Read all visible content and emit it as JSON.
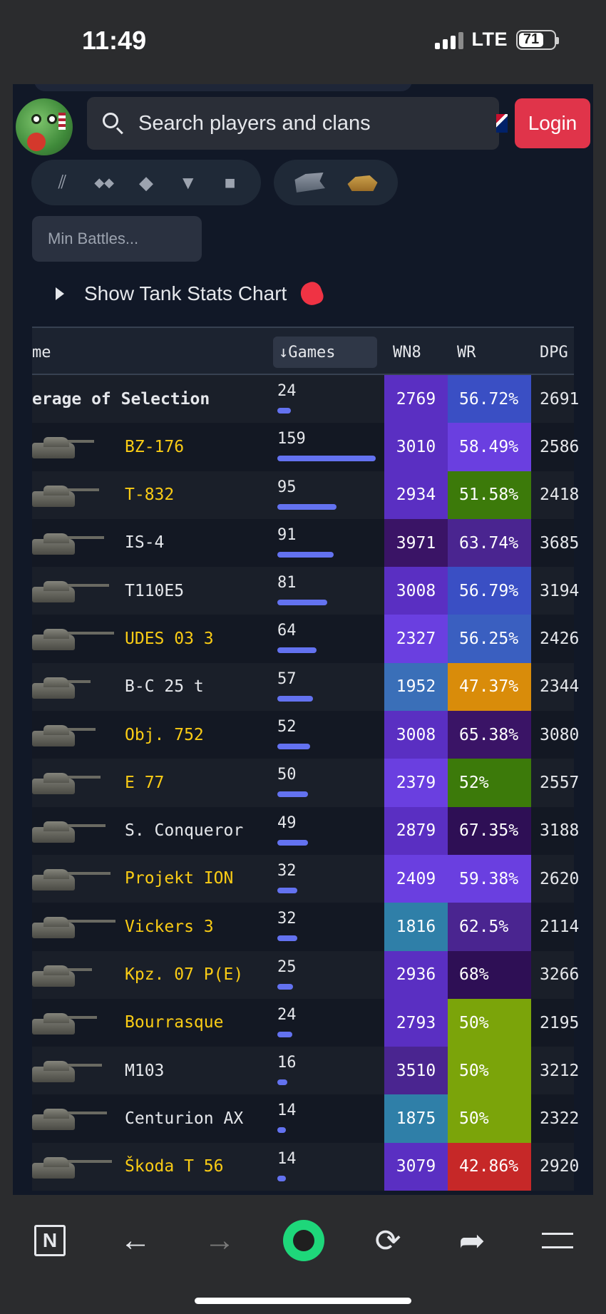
{
  "status_bar": {
    "time": "11:49",
    "network": "LTE",
    "battery": "71"
  },
  "header": {
    "search_placeholder": "Search players and clans",
    "login_label": "Login"
  },
  "filters": {
    "tier_icons": [
      "tier-x-icon",
      "tier-ix-icon",
      "diamond-icon",
      "triangle-down-icon",
      "square-icon"
    ],
    "tier_glyphs": [
      "⫽",
      "◆◆",
      "◆",
      "▼",
      "■"
    ],
    "type_icons": [
      "tank-type-heavy-icon",
      "tank-type-gold-icon"
    ],
    "min_battles_placeholder": "Min Battles...",
    "chart_toggle_label": "Show Tank Stats Chart"
  },
  "table": {
    "columns": {
      "name": "me",
      "games": "↓Games",
      "wn8": "WN8",
      "wr": "WR",
      "dpg": "DPG"
    },
    "rows": [
      {
        "name": "erage of Selection",
        "premium": false,
        "games": "24",
        "bar": 0.14,
        "wn8": "2769",
        "wn8_color": "#5a2fc2",
        "wr": "56.72%",
        "wr_color": "#3a4fc4",
        "dpg": "2691",
        "summary": true
      },
      {
        "name": "BZ-176",
        "premium": true,
        "games": "159",
        "bar": 1.0,
        "wn8": "3010",
        "wn8_color": "#5a2fc2",
        "wr": "58.49%",
        "wr_color": "#6a3fe0",
        "dpg": "2586"
      },
      {
        "name": "T-832",
        "premium": true,
        "games": "95",
        "bar": 0.6,
        "wn8": "2934",
        "wn8_color": "#5a2fc2",
        "wr": "51.58%",
        "wr_color": "#3c7a0a",
        "dpg": "2418"
      },
      {
        "name": "IS-4",
        "premium": false,
        "games": "91",
        "bar": 0.57,
        "wn8": "3971",
        "wn8_color": "#3a1466",
        "wr": "63.74%",
        "wr_color": "#4a2590",
        "dpg": "3685"
      },
      {
        "name": "T110E5",
        "premium": false,
        "games": "81",
        "bar": 0.51,
        "wn8": "3008",
        "wn8_color": "#5a2fc2",
        "wr": "56.79%",
        "wr_color": "#3a4fc4",
        "dpg": "3194"
      },
      {
        "name": "UDES 03 3",
        "premium": true,
        "games": "64",
        "bar": 0.4,
        "wn8": "2327",
        "wn8_color": "#6a3fe0",
        "wr": "56.25%",
        "wr_color": "#3a5fc0",
        "dpg": "2426"
      },
      {
        "name": "B-C 25 t",
        "premium": false,
        "games": "57",
        "bar": 0.36,
        "wn8": "1952",
        "wn8_color": "#3a6fb8",
        "wr": "47.37%",
        "wr_color": "#d98c0a",
        "dpg": "2344"
      },
      {
        "name": "Obj. 752",
        "premium": true,
        "games": "52",
        "bar": 0.33,
        "wn8": "3008",
        "wn8_color": "#5a2fc2",
        "wr": "65.38%",
        "wr_color": "#3a1466",
        "dpg": "3080"
      },
      {
        "name": "E 77",
        "premium": true,
        "games": "50",
        "bar": 0.31,
        "wn8": "2379",
        "wn8_color": "#6a3fe0",
        "wr": "52%",
        "wr_color": "#3c7a0a",
        "dpg": "2557"
      },
      {
        "name": "S. Conqueror",
        "premium": false,
        "games": "49",
        "bar": 0.31,
        "wn8": "2879",
        "wn8_color": "#5a2fc2",
        "wr": "67.35%",
        "wr_color": "#2e0f55",
        "dpg": "3188"
      },
      {
        "name": "Projekt ION",
        "premium": true,
        "games": "32",
        "bar": 0.2,
        "wn8": "2409",
        "wn8_color": "#6a3fe0",
        "wr": "59.38%",
        "wr_color": "#6a3fe0",
        "dpg": "2620"
      },
      {
        "name": "Vickers 3",
        "premium": true,
        "games": "32",
        "bar": 0.2,
        "wn8": "1816",
        "wn8_color": "#2f7fa8",
        "wr": "62.5%",
        "wr_color": "#4a2590",
        "dpg": "2114"
      },
      {
        "name": "Kpz. 07 P(E)",
        "premium": true,
        "games": "25",
        "bar": 0.16,
        "wn8": "2936",
        "wn8_color": "#5a2fc2",
        "wr": "68%",
        "wr_color": "#2e0f55",
        "dpg": "3266"
      },
      {
        "name": "Bourrasque",
        "premium": true,
        "games": "24",
        "bar": 0.15,
        "wn8": "2793",
        "wn8_color": "#5a2fc2",
        "wr": "50%",
        "wr_color": "#7ba40a",
        "dpg": "2195"
      },
      {
        "name": "M103",
        "premium": false,
        "games": "16",
        "bar": 0.1,
        "wn8": "3510",
        "wn8_color": "#4a2590",
        "wr": "50%",
        "wr_color": "#7ba40a",
        "dpg": "3212"
      },
      {
        "name": "Centurion AX",
        "premium": false,
        "games": "14",
        "bar": 0.09,
        "wn8": "1875",
        "wn8_color": "#2f7fa8",
        "wr": "50%",
        "wr_color": "#7ba40a",
        "dpg": "2322"
      },
      {
        "name": "Škoda T 56",
        "premium": true,
        "games": "14",
        "bar": 0.09,
        "wn8": "3079",
        "wn8_color": "#5a2fc2",
        "wr": "42.86%",
        "wr_color": "#c62828",
        "dpg": "2920"
      }
    ]
  },
  "bottom_nav": [
    "notion-icon",
    "back-arrow-icon",
    "forward-arrow-icon",
    "opera-icon",
    "reload-icon",
    "share-icon",
    "menu-icon"
  ]
}
